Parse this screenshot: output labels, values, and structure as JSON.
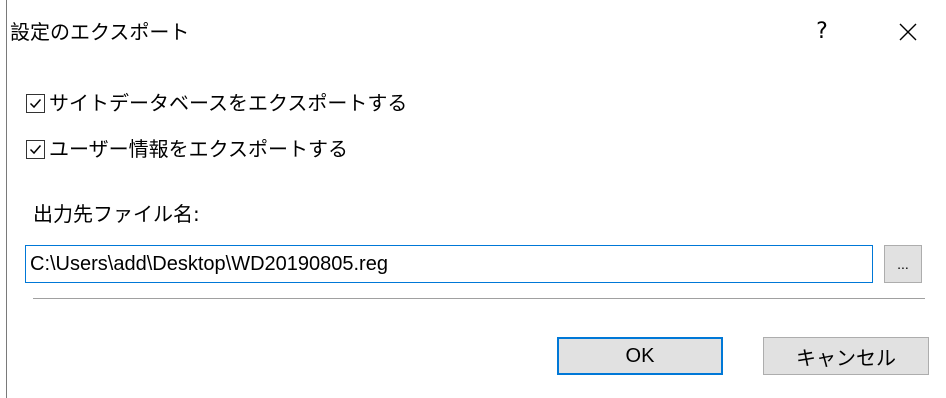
{
  "dialog": {
    "title": "設定のエクスポート",
    "help_label": "?"
  },
  "options": [
    {
      "label": "サイトデータベースをエクスポートする",
      "checked": true
    },
    {
      "label": "ユーザー情報をエクスポートする",
      "checked": true
    }
  ],
  "output": {
    "label": "出力先ファイル名:",
    "value": "C:\\Users\\add\\Desktop\\WD20190805.reg",
    "browse_label": "..."
  },
  "buttons": {
    "ok_label": "OK",
    "cancel_label": "キャンセル"
  },
  "colors": {
    "focus_accent": "#0078d7",
    "button_face": "#e1e1e1"
  },
  "icons": {
    "close": "close-icon",
    "checkbox": "checkmark-icon"
  }
}
